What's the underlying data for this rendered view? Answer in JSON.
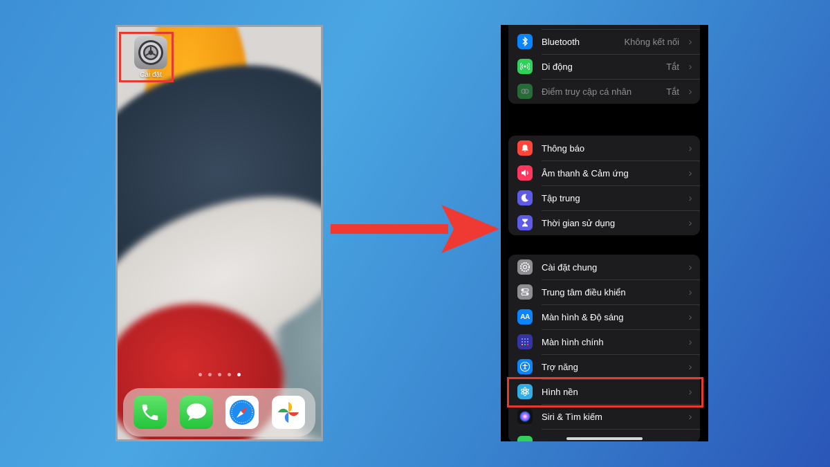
{
  "left_phone": {
    "app_label": "Cài đặt",
    "page_dots": 5,
    "active_dot": 5,
    "dock": [
      "phone-icon",
      "messages-icon",
      "safari-icon",
      "photos-icon"
    ]
  },
  "settings_groups": [
    {
      "rows": [
        {
          "label": "Bluetooth",
          "value": "Không kết nối",
          "icon": "bluetooth-icon",
          "color": "#0a84ff"
        },
        {
          "label": "Di động",
          "value": "Tắt",
          "icon": "cellular-icon",
          "color": "#30d158"
        },
        {
          "label": "Điểm truy cập cá nhân",
          "value": "Tắt",
          "icon": "hotspot-icon",
          "color": "#30d158",
          "dimmed": true
        }
      ]
    },
    {
      "rows": [
        {
          "label": "Thông báo",
          "value": "",
          "icon": "notifications-icon",
          "color": "#ff453a"
        },
        {
          "label": "Âm thanh & Cảm ứng",
          "value": "",
          "icon": "sound-icon",
          "color": "#ff375f"
        },
        {
          "label": "Tập trung",
          "value": "",
          "icon": "focus-moon-icon",
          "color": "#5e5ce6"
        },
        {
          "label": "Thời gian sử dụng",
          "value": "",
          "icon": "screen-time-icon",
          "color": "#5e5ce6"
        }
      ]
    },
    {
      "rows": [
        {
          "label": "Cài đặt chung",
          "value": "",
          "icon": "gear-icon",
          "color": "#8e8e93"
        },
        {
          "label": "Trung tâm điều khiển",
          "value": "",
          "icon": "control-center-icon",
          "color": "#8e8e93"
        },
        {
          "label": "Màn hình & Độ sáng",
          "value": "",
          "icon": "display-brightness-icon",
          "color": "#0a84ff"
        },
        {
          "label": "Màn hình chính",
          "value": "",
          "icon": "home-screen-icon",
          "color": "#3634a3"
        },
        {
          "label": "Trợ năng",
          "value": "",
          "icon": "accessibility-icon",
          "color": "#0a84ff"
        },
        {
          "label": "Hình nền",
          "value": "",
          "icon": "wallpaper-icon",
          "color": "#32ade6"
        },
        {
          "label": "Siri & Tìm kiếm",
          "value": "",
          "icon": "siri-icon",
          "color": "#1c1c1e"
        }
      ]
    }
  ],
  "colors": {
    "highlight": "#e8392f",
    "arrow": "#ee3a33"
  }
}
